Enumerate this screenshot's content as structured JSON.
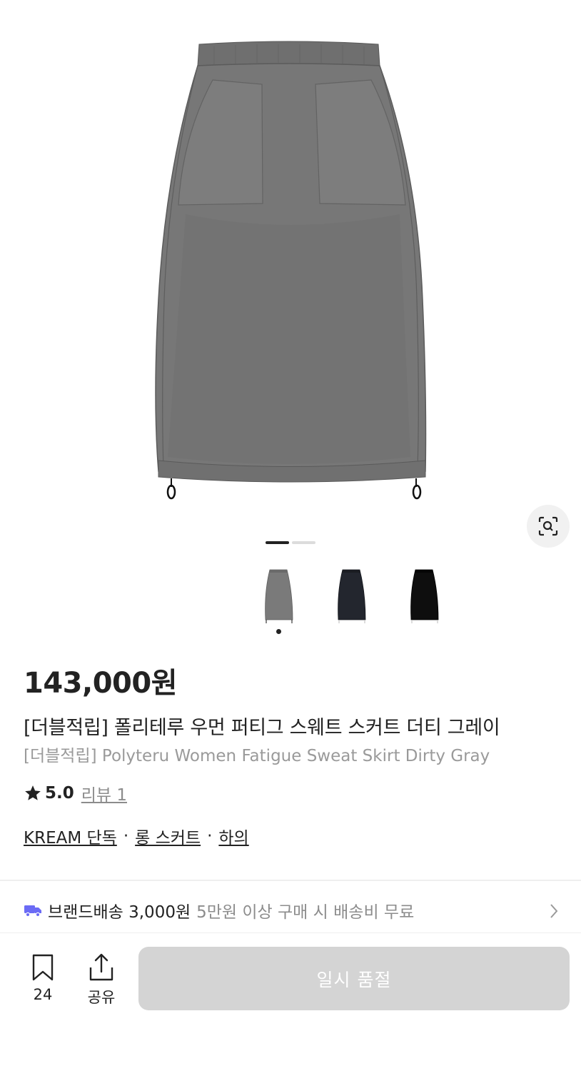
{
  "gallery": {
    "image_alt": "gray sweat skirt product image",
    "pager": {
      "count": 2,
      "active": 0
    },
    "thumbnails": [
      {
        "name": "gray",
        "color": "#7a7a7a",
        "selected": true
      },
      {
        "name": "navy",
        "color": "#23262e",
        "selected": false
      },
      {
        "name": "black",
        "color": "#0e0e0e",
        "selected": false
      }
    ],
    "lens_icon": "lens-search-icon"
  },
  "product": {
    "price": "143,000원",
    "title_ko": "[더블적립] 폴리테루 우먼 퍼티그 스웨트 스커트 더티 그레이",
    "title_en": "[더블적립] Polyteru Women Fatigue Sweat Skirt Dirty Gray",
    "rating": {
      "score": "5.0",
      "review_label": "리뷰 1"
    },
    "tags": [
      "KREAM 단독",
      "롱 스커트",
      "하의"
    ],
    "tag_separator": "·"
  },
  "shipping": {
    "icon": "truck-icon",
    "label": "브랜드배송 3,000원",
    "note": "5만원 이상 구매 시 배송비 무료",
    "accent": "#6b6bf5"
  },
  "bottom_bar": {
    "bookmark_count": "24",
    "share_label": "공유",
    "primary_button_label": "일시 품절",
    "primary_button_color": "#d4d4d4"
  }
}
